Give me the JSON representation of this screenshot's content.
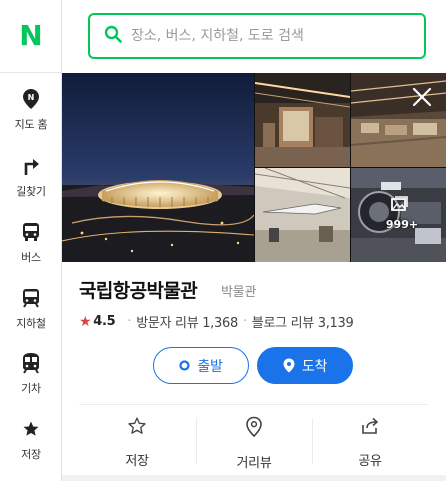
{
  "brand": {
    "logo_text": "N",
    "accent": "#03c75a",
    "primary": "#1a73e8"
  },
  "search": {
    "placeholder": "장소, 버스, 지하철, 도로 검색",
    "icon": "search-icon"
  },
  "nav": {
    "items": [
      {
        "label": "지도 홈",
        "icon": "map-pin-icon"
      },
      {
        "label": "길찾기",
        "icon": "directions-icon"
      },
      {
        "label": "버스",
        "icon": "bus-icon"
      },
      {
        "label": "지하철",
        "icon": "subway-icon"
      },
      {
        "label": "기차",
        "icon": "train-icon"
      },
      {
        "label": "저장",
        "icon": "star-icon"
      }
    ]
  },
  "gallery": {
    "photo_count": "999+",
    "close_icon": "close-icon",
    "photo_icon": "photo-stack-icon"
  },
  "place": {
    "name": "국립항공박물관",
    "category": "박물관",
    "rating": "4.5",
    "visitor_reviews": "방문자 리뷰 1,368",
    "blog_reviews": "블로그 리뷰 3,139"
  },
  "actions": {
    "start_label": "출발",
    "arrive_label": "도착"
  },
  "tools": [
    {
      "label": "저장",
      "icon": "star-outline-icon"
    },
    {
      "label": "거리뷰",
      "icon": "street-view-icon"
    },
    {
      "label": "공유",
      "icon": "share-icon"
    }
  ]
}
